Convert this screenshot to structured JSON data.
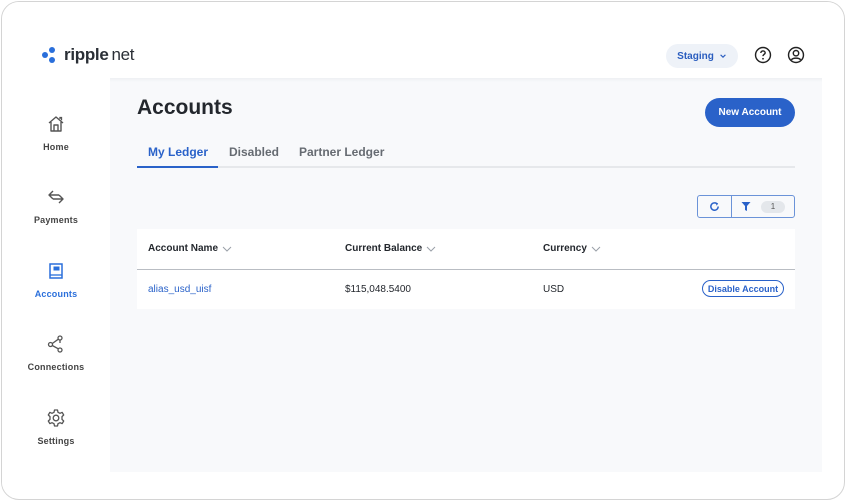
{
  "brand": {
    "name_strong": "ripple",
    "name_light": "net",
    "accent": "#2a62c9"
  },
  "header": {
    "environment": "Staging",
    "help_icon": "question-circle-icon",
    "user_icon": "user-circle-icon"
  },
  "sidebar": {
    "items": [
      {
        "label": "Home",
        "icon": "home-icon",
        "active": false
      },
      {
        "label": "Payments",
        "icon": "arrows-exchange-icon",
        "active": false
      },
      {
        "label": "Accounts",
        "icon": "ledger-book-icon",
        "active": true
      },
      {
        "label": "Connections",
        "icon": "share-nodes-icon",
        "active": false
      },
      {
        "label": "Settings",
        "icon": "gear-icon",
        "active": false
      }
    ]
  },
  "main": {
    "title": "Accounts",
    "new_button": "New Account",
    "tabs": [
      {
        "label": "My Ledger",
        "active": true
      },
      {
        "label": "Disabled",
        "active": false
      },
      {
        "label": "Partner Ledger",
        "active": false
      }
    ],
    "toolbar": {
      "refresh_icon": "refresh-icon",
      "filter_icon": "filter-icon",
      "filter_count": "1"
    },
    "table": {
      "columns": [
        "Account Name",
        "Current Balance",
        "Currency"
      ],
      "rows": [
        {
          "account_name": "alias_usd_uisf",
          "current_balance": "$115,048.5400",
          "currency": "USD",
          "action": "Disable Account"
        }
      ]
    }
  }
}
